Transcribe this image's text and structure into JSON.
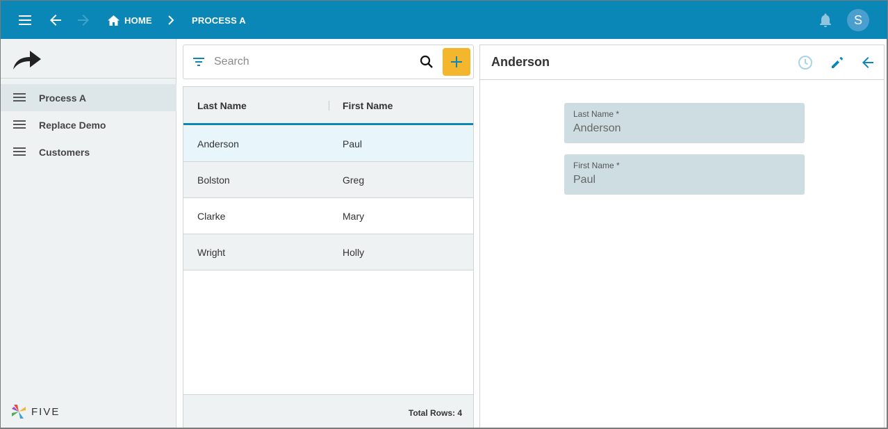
{
  "topbar": {
    "breadcrumbs": [
      {
        "label": "HOME",
        "icon": "home-icon"
      },
      {
        "label": "PROCESS A"
      }
    ],
    "avatar_initial": "S",
    "icons": [
      "menu-icon",
      "back-arrow-icon",
      "forward-arrow-icon",
      "chevron-right-icon",
      "bell-icon"
    ]
  },
  "sidebar": {
    "logo_icon": "redo-arrow-icon",
    "items": [
      {
        "label": "Process A",
        "icon": "list-icon",
        "active": true
      },
      {
        "label": "Replace Demo",
        "icon": "list-icon",
        "active": false
      },
      {
        "label": "Customers",
        "icon": "list-icon",
        "active": false
      }
    ],
    "brand": "FIVE"
  },
  "list": {
    "search_placeholder": "Search",
    "columns": [
      "Last Name",
      "First Name"
    ],
    "rows": [
      [
        "Anderson",
        "Paul"
      ],
      [
        "Bolston",
        "Greg"
      ],
      [
        "Clarke",
        "Mary"
      ],
      [
        "Wright",
        "Holly"
      ]
    ],
    "selected_row": 0,
    "footer": "Total Rows: 4"
  },
  "detail": {
    "title": "Anderson",
    "fields": [
      {
        "label": "Last Name *",
        "value": "Anderson"
      },
      {
        "label": "First Name *",
        "value": "Paul"
      }
    ],
    "actions": [
      "history-icon",
      "edit-pencil-icon",
      "back-arrow-icon"
    ]
  },
  "colors": {
    "primary": "#0a87b7",
    "accent": "#f4b62c",
    "sidebar_bg": "#eff2f3",
    "selected_row_bg": "#e8f6fc",
    "field_bg": "#cddde2"
  }
}
